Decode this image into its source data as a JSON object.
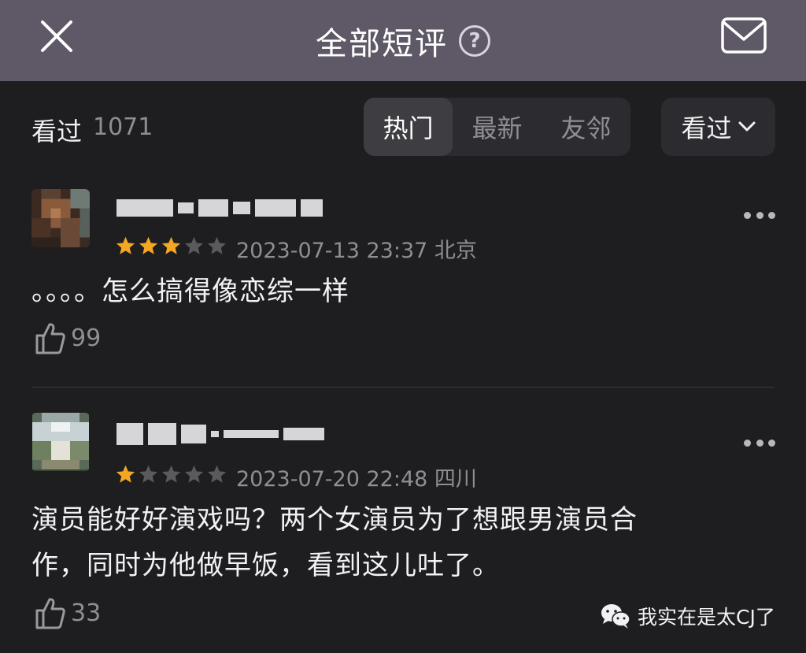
{
  "header": {
    "title": "全部短评",
    "help_icon": "?"
  },
  "filters": {
    "watched_label": "看过",
    "watched_count": "1071",
    "tabs": [
      {
        "label": "热门",
        "active": true
      },
      {
        "label": "最新",
        "active": false
      },
      {
        "label": "友邻",
        "active": false
      }
    ],
    "dropdown_label": "看过"
  },
  "comments": [
    {
      "rating": 3,
      "max_rating": 5,
      "datetime": "2023-07-13 23:37",
      "location": "北京",
      "text": "。。。。怎么搞得像恋综一样",
      "likes": "99"
    },
    {
      "rating": 1,
      "max_rating": 5,
      "datetime": "2023-07-20 22:48",
      "location": "四川",
      "text_line1": "演员能好好演戏吗？两个女演员为了想跟男演员合",
      "text_line2": "作，同时为他做早饭，看到这儿吐了。",
      "likes": "33"
    }
  ],
  "watermark": {
    "text": "我实在是太CJ了"
  },
  "colors": {
    "header_bg": "#5f5866",
    "page_bg": "#1e1e20",
    "star_on": "#f5a623",
    "star_off": "#5a5a5e"
  }
}
